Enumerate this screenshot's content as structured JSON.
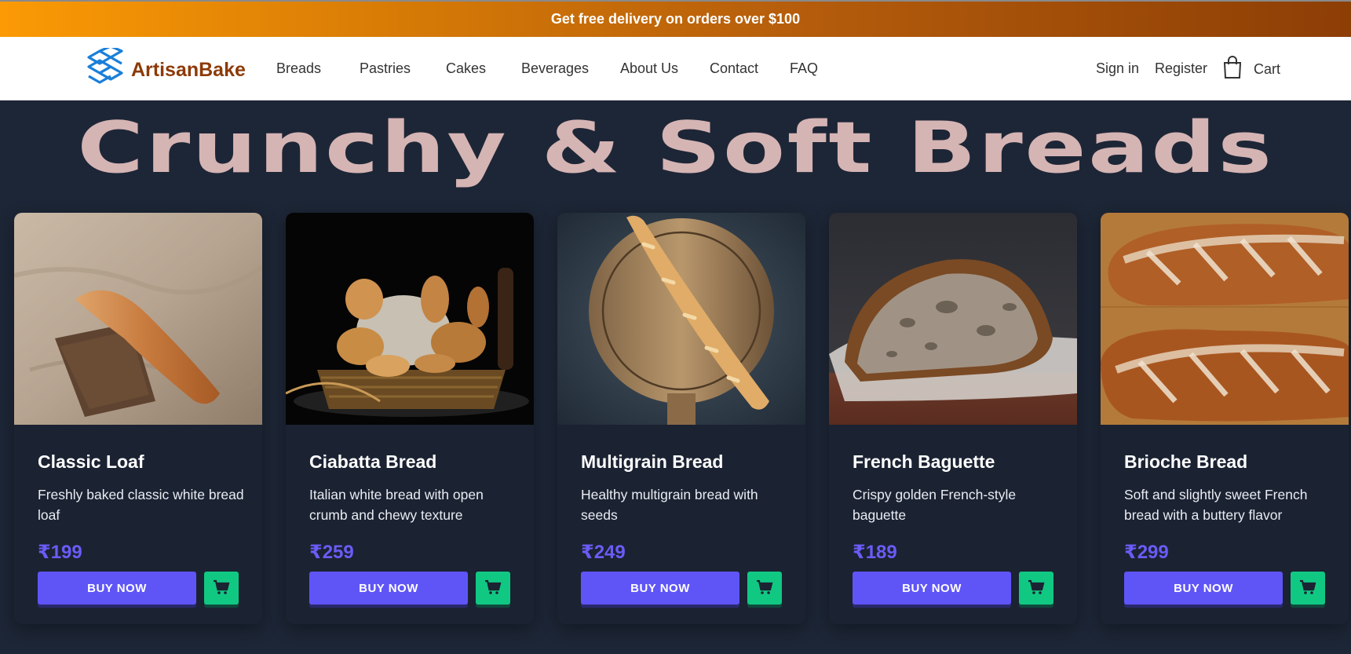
{
  "promo": {
    "text": "Get free delivery on orders over $100"
  },
  "brand": {
    "name": "ArtisanBake"
  },
  "nav": {
    "links": [
      "Breads",
      "Pastries",
      "Cakes",
      "Beverages",
      "About Us",
      "Contact",
      "FAQ"
    ],
    "sign_in": "Sign in",
    "register": "Register",
    "cart": "Cart"
  },
  "hero": {
    "title": "Crunchy & Soft Breads"
  },
  "products": [
    {
      "name": "Classic Loaf",
      "description": "Freshly baked classic white bread loaf",
      "price": "₹199",
      "buy_label": "BUY NOW",
      "image": "baguette-on-linen"
    },
    {
      "name": "Ciabatta Bread",
      "description": "Italian white bread with open crumb and chewy texture",
      "price": "₹259",
      "buy_label": "BUY NOW",
      "image": "bread-basket-dark"
    },
    {
      "name": "Multigrain Bread",
      "description": "Healthy multigrain bread with seeds",
      "price": "₹249",
      "buy_label": "BUY NOW",
      "image": "baguette-on-board"
    },
    {
      "name": "French Baguette",
      "description": "Crispy golden French-style baguette",
      "price": "₹189",
      "buy_label": "BUY NOW",
      "image": "sourdough-halved"
    },
    {
      "name": "Brioche Bread",
      "description": "Soft and slightly sweet French bread with a buttery flavor",
      "price": "₹299",
      "buy_label": "BUY NOW",
      "image": "two-baguettes"
    }
  ],
  "colors": {
    "accent": "#5f55f7",
    "cart_button": "#11c883",
    "price": "#6a5cf6",
    "brand": "#8c3a08",
    "headline": "#d5b4b4",
    "background": "#1d2636"
  }
}
